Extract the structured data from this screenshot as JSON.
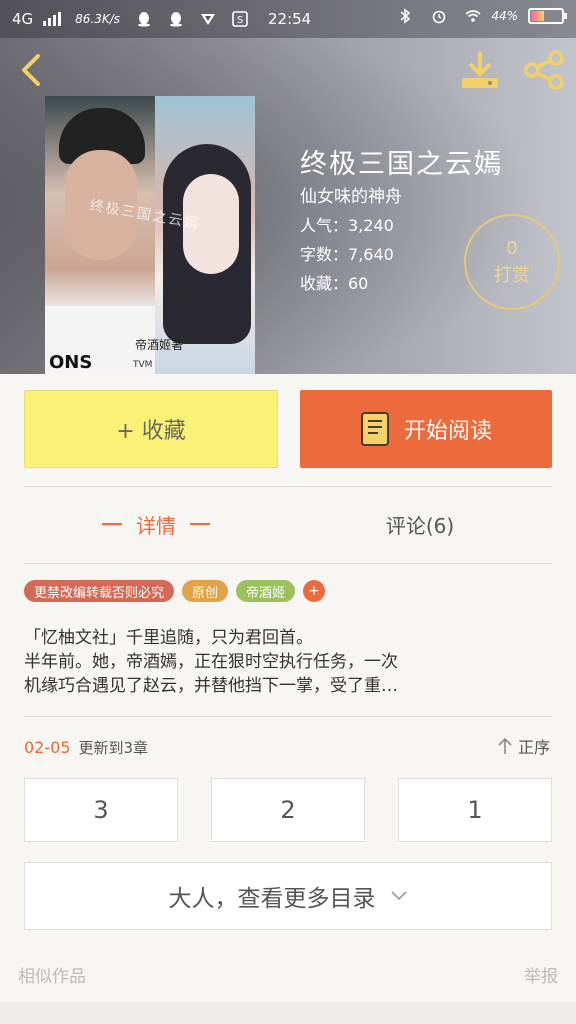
{
  "status_bar": {
    "network": "4G",
    "speed": "86.3K/s",
    "time": "22:54",
    "battery": "44%",
    "battery_level": 0.44,
    "icons": [
      "signal-icon",
      "qq-icon",
      "qq-icon",
      "vpn-icon",
      "s-app-icon",
      "bluetooth-icon",
      "alarm-icon",
      "wifi-icon",
      "battery-icon"
    ]
  },
  "header": {
    "back_icon": "chevron-left-icon",
    "download_icon": "download-icon",
    "share_icon": "share-icon",
    "icon_color": "#f2d067"
  },
  "cover": {
    "overlay_title": "终极三国之云嫣",
    "author_mark": "帝酒姬著",
    "print_text": "ONS",
    "print_small": "TVM"
  },
  "book": {
    "title": "终极三国之云嫣",
    "author": "仙女味的神舟",
    "popularity": "人气：3,240",
    "word_count": "字数：7,640",
    "favorites": "收藏：60",
    "tip_count": "0",
    "tip_label": "打赏"
  },
  "actions": {
    "favorite_label": "+ 收藏",
    "read_label": "开始阅读",
    "read_icon": "book-icon",
    "accent": "#ec6a3b",
    "favorite_bg": "#fbf177"
  },
  "tabs": [
    {
      "label": "详情",
      "active": true
    },
    {
      "label": "评论(6)",
      "active": false
    }
  ],
  "tags": [
    {
      "label": "更禁改编转载否则必究",
      "color": "#d26a55"
    },
    {
      "label": "原创",
      "color": "#e0a347"
    },
    {
      "label": "帝酒姬",
      "color": "#9cc05c"
    }
  ],
  "tag_add": "+",
  "synopsis": {
    "line1": "「忆柚文社」千里追随，只为君回首。",
    "line2": "半年前。她，帝酒嫣，正在狠时空执行任务，一次",
    "line3": "机缘巧合遇见了赵云，并替他挡下一掌，受了重…"
  },
  "update": {
    "date": "02-05",
    "text": "更新到3章",
    "sort_label": "正序",
    "sort_icon": "arrow-up-icon"
  },
  "chapters": [
    "3",
    "2",
    "1"
  ],
  "more_catalog": {
    "label": "大人，查看更多目录",
    "icon": "chevron-down-icon"
  },
  "footer": {
    "similar": "相似作品",
    "report": "举报"
  }
}
